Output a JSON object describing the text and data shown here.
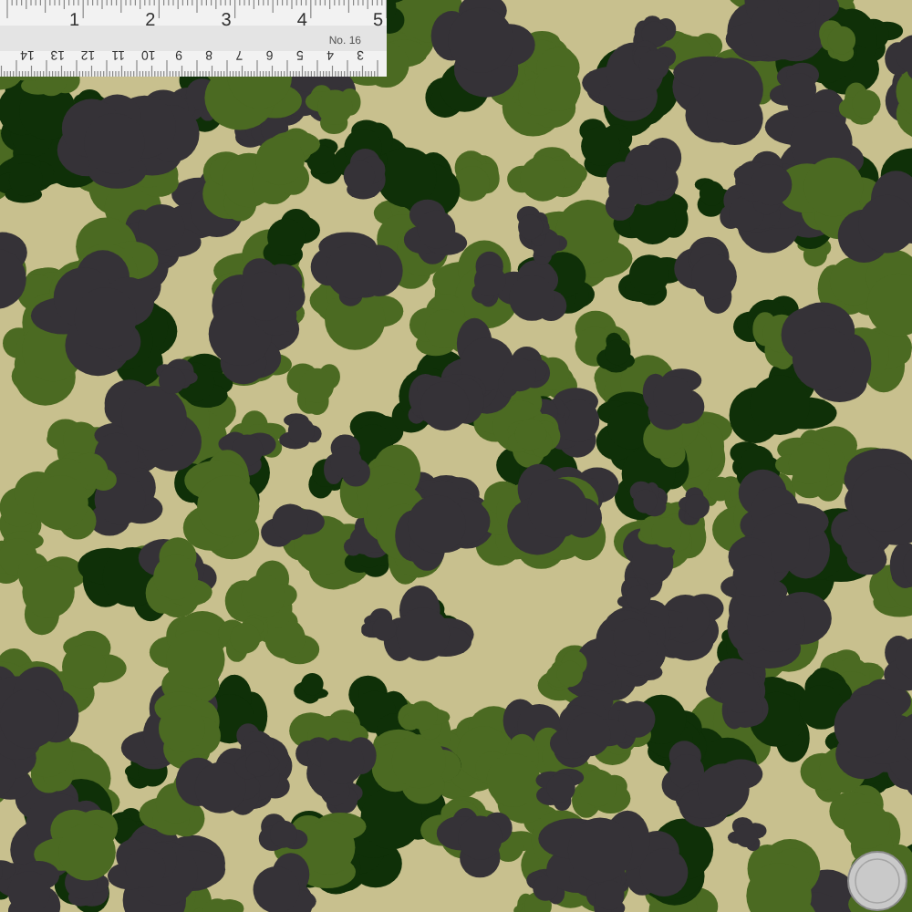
{
  "ruler": {
    "inch_labels": [
      "1",
      "2",
      "3",
      "4",
      "5"
    ],
    "model": "No. 16",
    "cm_labels": [
      "14",
      "13",
      "12",
      "11",
      "10",
      "9",
      "8",
      "7",
      "6",
      "5",
      "4",
      "3"
    ]
  }
}
